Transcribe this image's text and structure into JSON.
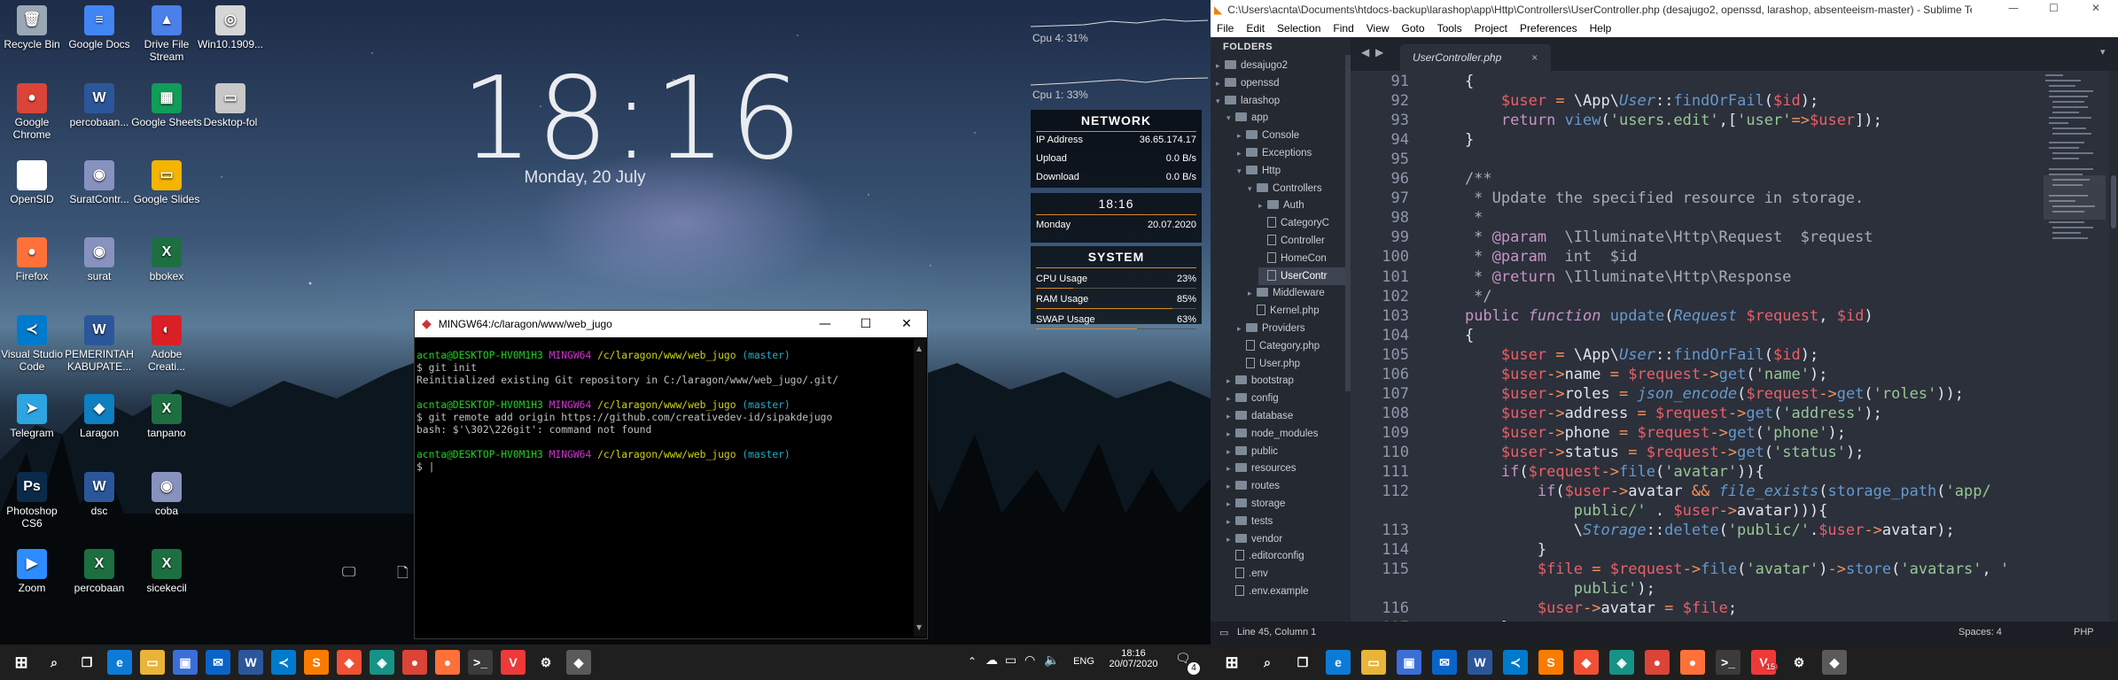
{
  "desktop_icons": [
    {
      "label": "Recycle Bin",
      "icon": "recycle-bin-icon",
      "glyph": "🗑",
      "color": "#9aa7b5"
    },
    {
      "label": "Google Docs",
      "icon": "google-docs-icon",
      "glyph": "≡",
      "color": "#4285f4"
    },
    {
      "label": "Drive File Stream",
      "icon": "google-drive-icon",
      "glyph": "▲",
      "color": "#4a80e8"
    },
    {
      "label": "Win10.1909...",
      "icon": "disc-image-icon",
      "glyph": "◎",
      "color": "#d6d6d6"
    },
    {
      "label": "Google Chrome",
      "icon": "chrome-icon",
      "glyph": "●",
      "color": "#db4437"
    },
    {
      "label": "percobaan...",
      "icon": "word-document-icon",
      "glyph": "W",
      "color": "#2b579a"
    },
    {
      "label": "Google Sheets",
      "icon": "google-sheets-icon",
      "glyph": "▦",
      "color": "#0f9d58"
    },
    {
      "label": "Desktop-fol",
      "icon": "folder-shortcut-icon",
      "glyph": "▭",
      "color": "#c8c8c8"
    },
    {
      "label": "OpenSID",
      "icon": "file-icon",
      "glyph": "",
      "color": "#ffffff"
    },
    {
      "label": "SuratContr...",
      "icon": "php-file-icon",
      "glyph": "◉",
      "color": "#8892bf"
    },
    {
      "label": "Google Slides",
      "icon": "google-slides-icon",
      "glyph": "▭",
      "color": "#f4b400"
    },
    {
      "label": "Firefox",
      "icon": "firefox-icon",
      "glyph": "●",
      "color": "#ff7139"
    },
    {
      "label": "surat",
      "icon": "php-file-icon",
      "glyph": "◉",
      "color": "#8892bf"
    },
    {
      "label": "bbokex",
      "icon": "excel-file-icon",
      "glyph": "X",
      "color": "#1d6f42"
    },
    {
      "label": "Visual Studio Code",
      "icon": "vscode-icon",
      "glyph": "≺",
      "color": "#007acc"
    },
    {
      "label": "PEMERINTAH KABUPATE...",
      "icon": "word-document-icon",
      "glyph": "W",
      "color": "#2b579a"
    },
    {
      "label": "Adobe Creati...",
      "icon": "adobe-cc-icon",
      "glyph": "◐",
      "color": "#da1f26"
    },
    {
      "label": "Telegram",
      "icon": "telegram-icon",
      "glyph": "➤",
      "color": "#2ca5e0"
    },
    {
      "label": "Laragon",
      "icon": "laragon-icon",
      "glyph": "◆",
      "color": "#0e7fc0"
    },
    {
      "label": "tanpano",
      "icon": "excel-file-icon",
      "glyph": "X",
      "color": "#1d6f42"
    },
    {
      "label": "Photoshop CS6",
      "icon": "photoshop-icon",
      "glyph": "Ps",
      "color": "#0b2a4a"
    },
    {
      "label": "dsc",
      "icon": "word-document-icon",
      "glyph": "W",
      "color": "#2b579a"
    },
    {
      "label": "coba",
      "icon": "php-file-icon",
      "glyph": "◉",
      "color": "#8892bf"
    },
    {
      "label": "Zoom",
      "icon": "zoom-icon",
      "glyph": "▶",
      "color": "#2d8cff"
    },
    {
      "label": "percobaan",
      "icon": "excel-file-icon",
      "glyph": "X",
      "color": "#1d6f42"
    },
    {
      "label": "sicekecil",
      "icon": "excel-file-icon",
      "glyph": "X",
      "color": "#1d6f42"
    }
  ],
  "clock_widget": {
    "time": "18:16",
    "date": "Monday, 20 July"
  },
  "cpu": {
    "cpu4": "Cpu 4: 31%",
    "cpu1": "Cpu 1: 33%"
  },
  "network": {
    "title": "NETWORK",
    "rows": [
      {
        "label": "IP Address",
        "value": "36.65.174.17"
      },
      {
        "label": "Upload",
        "value": "0.0 B/s"
      },
      {
        "label": "Download",
        "value": "0.0 B/s"
      }
    ]
  },
  "time_panel": {
    "time": "18:16",
    "day": "Monday",
    "date": "20.07.2020"
  },
  "system": {
    "title": "SYSTEM",
    "rows": [
      {
        "label": "CPU Usage",
        "value": "23%",
        "level": 0.23
      },
      {
        "label": "RAM Usage",
        "value": "85%",
        "level": 0.85
      },
      {
        "label": "SWAP Usage",
        "value": "63%",
        "level": 0.63
      }
    ]
  },
  "terminal": {
    "title": "MINGW64:/c/laragon/www/web_jugo",
    "lines": [
      {
        "user": "acnta@DESKTOP-HV0M1H3",
        "env": "MINGW64",
        "path": "/c/laragon/www/web_jugo",
        "branch": "(master)"
      },
      {
        "text": "$ git init"
      },
      {
        "text": "Reinitialized existing Git repository in C:/laragon/www/web_jugo/.git/"
      },
      {
        "text": ""
      },
      {
        "user": "acnta@DESKTOP-HV0M1H3",
        "env": "MINGW64",
        "path": "/c/laragon/www/web_jugo",
        "branch": "(master)"
      },
      {
        "text": "$ git remote add origin https://github.com/creativedev-id/sipakdejugo"
      },
      {
        "text": "bash: $'\\302\\226git': command not found"
      },
      {
        "text": ""
      },
      {
        "user": "acnta@DESKTOP-HV0M1H3",
        "env": "MINGW64",
        "path": "/c/laragon/www/web_jugo",
        "branch": "(master)"
      },
      {
        "text": "$ |"
      }
    ]
  },
  "taskbar_left": {
    "time": "18:16",
    "date": "20/07/2020",
    "lang": "ENG",
    "notifications": "4",
    "apps": [
      "windows-start-icon",
      "search-icon",
      "task-view-icon",
      "edge-icon",
      "file-explorer-icon",
      "store-icon",
      "mail-icon",
      "word-icon",
      "vscode-icon",
      "sublime-icon",
      "git-icon",
      "gitkraken-icon",
      "chrome-icon",
      "firefox-icon",
      "terminal-icon",
      "vivaldi-icon",
      "settings-icon",
      "git-bash-icon"
    ]
  },
  "sublime": {
    "title": "C:\\Users\\acnta\\Documents\\htdocs-backup\\larashop\\app\\Http\\Controllers\\UserController.php (desajugo2, openssd, larashop, absenteeism-master) - Sublime Te...",
    "menu": [
      "File",
      "Edit",
      "Selection",
      "Find",
      "View",
      "Goto",
      "Tools",
      "Project",
      "Preferences",
      "Help"
    ],
    "sidebar_header": "FOLDERS",
    "tab": "UserController.php",
    "status_left": "Line 45, Column 1",
    "status_spaces": "Spaces: 4",
    "status_syntax": "PHP",
    "tree": [
      {
        "label": "desajugo2",
        "depth": 0,
        "kind": "folder",
        "open": false
      },
      {
        "label": "openssd",
        "depth": 0,
        "kind": "folder",
        "open": false
      },
      {
        "label": "larashop",
        "depth": 0,
        "kind": "folder",
        "open": true
      },
      {
        "label": "app",
        "depth": 1,
        "kind": "folder",
        "open": true
      },
      {
        "label": "Console",
        "depth": 2,
        "kind": "folder",
        "open": false
      },
      {
        "label": "Exceptions",
        "depth": 2,
        "kind": "folder",
        "open": false
      },
      {
        "label": "Http",
        "depth": 2,
        "kind": "folder",
        "open": true
      },
      {
        "label": "Controllers",
        "depth": 3,
        "kind": "folder",
        "open": true
      },
      {
        "label": "Auth",
        "depth": 4,
        "kind": "folder",
        "open": false
      },
      {
        "label": "CategoryC",
        "depth": 4,
        "kind": "file"
      },
      {
        "label": "Controller",
        "depth": 4,
        "kind": "file"
      },
      {
        "label": "HomeCon",
        "depth": 4,
        "kind": "file"
      },
      {
        "label": "UserContr",
        "depth": 4,
        "kind": "file",
        "active": true
      },
      {
        "label": "Middleware",
        "depth": 3,
        "kind": "folder",
        "open": false
      },
      {
        "label": "Kernel.php",
        "depth": 3,
        "kind": "file"
      },
      {
        "label": "Providers",
        "depth": 2,
        "kind": "folder",
        "open": false
      },
      {
        "label": "Category.php",
        "depth": 2,
        "kind": "file"
      },
      {
        "label": "User.php",
        "depth": 2,
        "kind": "file"
      },
      {
        "label": "bootstrap",
        "depth": 1,
        "kind": "folder",
        "open": false
      },
      {
        "label": "config",
        "depth": 1,
        "kind": "folder",
        "open": false
      },
      {
        "label": "database",
        "depth": 1,
        "kind": "folder",
        "open": false
      },
      {
        "label": "node_modules",
        "depth": 1,
        "kind": "folder",
        "open": false
      },
      {
        "label": "public",
        "depth": 1,
        "kind": "folder",
        "open": false
      },
      {
        "label": "resources",
        "depth": 1,
        "kind": "folder",
        "open": false
      },
      {
        "label": "routes",
        "depth": 1,
        "kind": "folder",
        "open": false
      },
      {
        "label": "storage",
        "depth": 1,
        "kind": "folder",
        "open": false
      },
      {
        "label": "tests",
        "depth": 1,
        "kind": "folder",
        "open": false
      },
      {
        "label": "vendor",
        "depth": 1,
        "kind": "folder",
        "open": false
      },
      {
        "label": ".editorconfig",
        "depth": 1,
        "kind": "file"
      },
      {
        "label": ".env",
        "depth": 1,
        "kind": "file"
      },
      {
        "label": ".env.example",
        "depth": 1,
        "kind": "file"
      }
    ],
    "code_lines": [
      {
        "n": "91",
        "html": "    {"
      },
      {
        "n": "92",
        "html": "        <span class='var'>$user</span> <span class='op'>=</span> \\App\\<span class='cls'>User</span>::<span class='fn'>findOrFail</span>(<span class='var'>$id</span>);"
      },
      {
        "n": "93",
        "html": "        <span class='kw'>return</span> <span class='fn'>view</span>(<span class='str'>'users.edit'</span>,[<span class='str'>'user'</span><span class='op'>=></span><span class='var'>$user</span>]);"
      },
      {
        "n": "94",
        "html": "    }"
      },
      {
        "n": "95",
        "html": ""
      },
      {
        "n": "96",
        "html": "    <span class='cm'>/**</span>"
      },
      {
        "n": "97",
        "html": "<span class='cm'>     * Update the specified resource in storage.</span>"
      },
      {
        "n": "98",
        "html": "<span class='cm'>     *</span>"
      },
      {
        "n": "99",
        "html": "<span class='cm'>     * </span><span class='kw'>@param</span><span class='cm'>  \\Illuminate\\Http\\Request  $request</span>"
      },
      {
        "n": "100",
        "html": "<span class='cm'>     * </span><span class='kw'>@param</span><span class='cm'>  int  $id</span>"
      },
      {
        "n": "101",
        "html": "<span class='cm'>     * </span><span class='kw'>@return</span><span class='cm'> \\Illuminate\\Http\\Response</span>"
      },
      {
        "n": "102",
        "html": "<span class='cm'>     */</span>"
      },
      {
        "n": "103",
        "html": "    <span class='kw'>public</span> <span class='kw it'>function</span> <span class='fn'>update</span>(<span class='cls'>Request</span> <span class='var'>$request</span>, <span class='var'>$id</span>)"
      },
      {
        "n": "104",
        "html": "    {"
      },
      {
        "n": "105",
        "html": "        <span class='var'>$user</span> <span class='op'>=</span> \\App\\<span class='cls'>User</span>::<span class='fn'>findOrFail</span>(<span class='var'>$id</span>);"
      },
      {
        "n": "106",
        "html": "        <span class='var'>$user</span><span class='op'>-></span>name <span class='op'>=</span> <span class='var'>$request</span><span class='op'>-></span><span class='fn'>get</span>(<span class='str'>'name'</span>);"
      },
      {
        "n": "107",
        "html": "        <span class='var'>$user</span><span class='op'>-></span>roles <span class='op'>=</span> <span class='fn it'>json_encode</span>(<span class='var'>$request</span><span class='op'>-></span><span class='fn'>get</span>(<span class='str'>'roles'</span>));"
      },
      {
        "n": "108",
        "html": "        <span class='var'>$user</span><span class='op'>-></span>address <span class='op'>=</span> <span class='var'>$request</span><span class='op'>-></span><span class='fn'>get</span>(<span class='str'>'address'</span>);"
      },
      {
        "n": "109",
        "html": "        <span class='var'>$user</span><span class='op'>-></span>phone <span class='op'>=</span> <span class='var'>$request</span><span class='op'>-></span><span class='fn'>get</span>(<span class='str'>'phone'</span>);"
      },
      {
        "n": "110",
        "html": "        <span class='var'>$user</span><span class='op'>-></span>status <span class='op'>=</span> <span class='var'>$request</span><span class='op'>-></span><span class='fn'>get</span>(<span class='str'>'status'</span>);"
      },
      {
        "n": "111",
        "html": "        <span class='kw'>if</span>(<span class='var'>$request</span><span class='op'>-></span><span class='fn'>file</span>(<span class='str'>'avatar'</span>)){"
      },
      {
        "n": "112",
        "html": "            <span class='kw'>if</span>(<span class='var'>$user</span><span class='op'>-></span>avatar <span class='op'>&amp;&amp;</span> <span class='fn it'>file_exists</span>(<span class='fn'>storage_path</span>(<span class='str'>'app/</span>"
      },
      {
        "n": "",
        "html": "                <span class='str'>public/'</span> . <span class='var'>$user</span><span class='op'>-></span>avatar))){"
      },
      {
        "n": "113",
        "html": "                \\<span class='cls'>Storage</span>::<span class='fn'>delete</span>(<span class='str'>'public/'</span>.<span class='var'>$user</span><span class='op'>-></span>avatar);"
      },
      {
        "n": "114",
        "html": "            }"
      },
      {
        "n": "115",
        "html": "            <span class='var'>$file</span> <span class='op'>=</span> <span class='var'>$request</span><span class='op'>-></span><span class='fn'>file</span>(<span class='str'>'avatar'</span>)<span class='op'>-></span><span class='fn'>store</span>(<span class='str'>'avatars'</span>, <span class='str'>'</span>"
      },
      {
        "n": "",
        "html": "                <span class='str'>public'</span>);"
      },
      {
        "n": "116",
        "html": "            <span class='var'>$user</span><span class='op'>-></span>avatar <span class='op'>=</span> <span class='var'>$file</span>;"
      },
      {
        "n": "117",
        "html": "        }"
      }
    ]
  },
  "taskbar_right": {
    "badge": "15",
    "apps": [
      "windows-start-icon",
      "search-icon",
      "task-view-icon",
      "edge-icon",
      "file-explorer-icon",
      "store-icon",
      "mail-icon",
      "word-icon",
      "vscode-icon",
      "sublime-icon",
      "git-icon",
      "gitkraken-icon",
      "chrome-icon",
      "firefox-icon",
      "terminal-icon",
      "vivaldi-icon",
      "settings-icon",
      "git-bash-icon"
    ]
  }
}
